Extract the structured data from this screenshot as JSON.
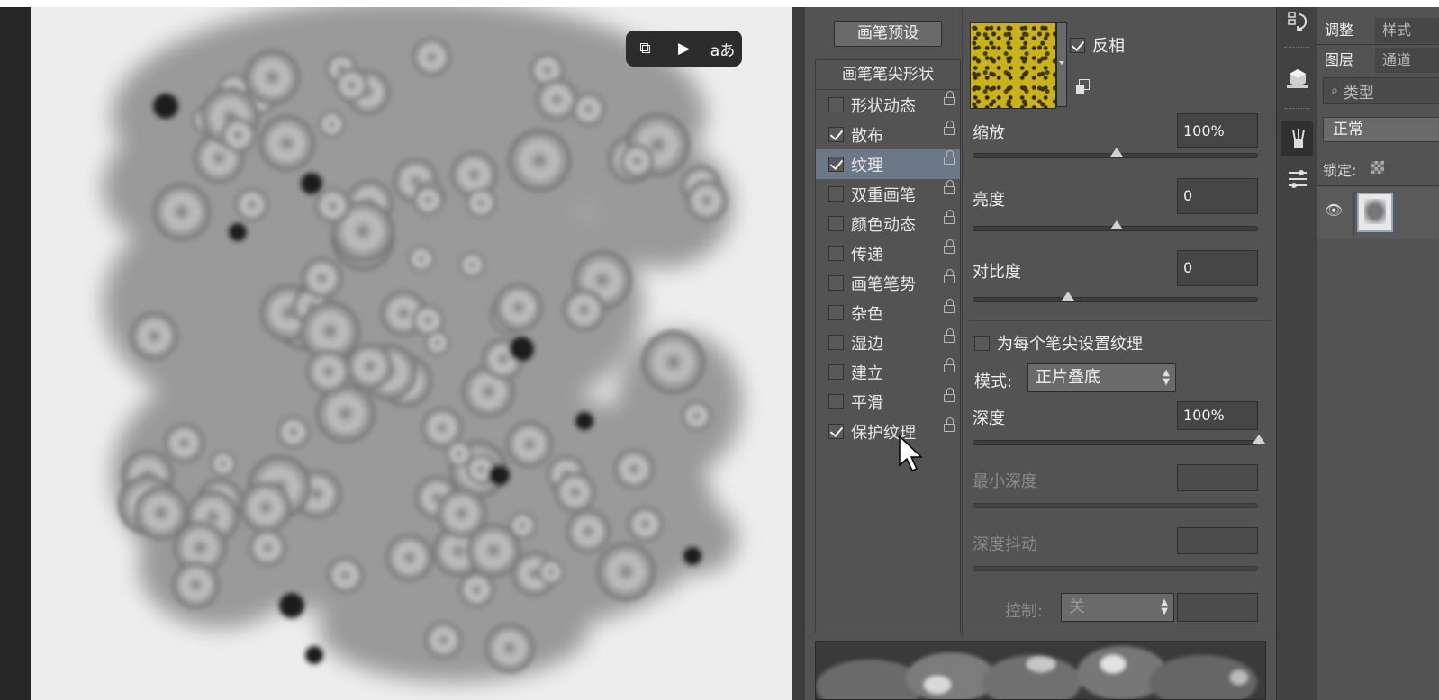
{
  "video_overlay": {
    "icons": [
      "picture-in-picture-icon",
      "video-sparkle-icon",
      "translate-icon"
    ],
    "translate_glyph": "aあ"
  },
  "brush_panel": {
    "preset_button": "画笔预设",
    "tip_shape_header": "画笔笔尖形状",
    "options": [
      {
        "label": "形状动态",
        "checked": false,
        "selected": false
      },
      {
        "label": "散布",
        "checked": true,
        "selected": false
      },
      {
        "label": "纹理",
        "checked": true,
        "selected": true
      },
      {
        "label": "双重画笔",
        "checked": false,
        "selected": false
      },
      {
        "label": "颜色动态",
        "checked": false,
        "selected": false
      },
      {
        "label": "传递",
        "checked": false,
        "selected": false
      },
      {
        "label": "画笔笔势",
        "checked": false,
        "selected": false
      },
      {
        "label": "杂色",
        "checked": false,
        "selected": false
      },
      {
        "label": "湿边",
        "checked": false,
        "selected": false
      },
      {
        "label": "建立",
        "checked": false,
        "selected": false
      },
      {
        "label": "平滑",
        "checked": false,
        "selected": false
      },
      {
        "label": "保护纹理",
        "checked": true,
        "selected": false
      }
    ],
    "texture": {
      "invert_label": "反相",
      "invert_checked": true,
      "scale": {
        "label": "缩放",
        "value": "100%",
        "slider": 0.5
      },
      "brightness": {
        "label": "亮度",
        "value": "0",
        "slider": 0.5
      },
      "contrast": {
        "label": "对比度",
        "value": "0",
        "slider": 0.33
      },
      "per_tip_label": "为每个笔尖设置纹理",
      "per_tip_checked": false,
      "mode_label": "模式:",
      "mode_value": "正片叠底",
      "depth": {
        "label": "深度",
        "value": "100%",
        "slider": 1.0
      },
      "min_depth": {
        "label": "最小深度",
        "value": ""
      },
      "depth_jitter": {
        "label": "深度抖动",
        "value": ""
      },
      "control_label": "控制:",
      "control_value": "关"
    }
  },
  "right_panel": {
    "tabs_top": [
      "调整",
      "样式"
    ],
    "tabs_layers": [
      "图层",
      "通道"
    ],
    "filter_placeholder": "类型",
    "blend_mode": "正常",
    "lock_label": "锁定:"
  },
  "colors": {
    "panel_bg": "#535353",
    "selected_row": "#6c7787",
    "texture_yellow": "#c9b21c"
  }
}
